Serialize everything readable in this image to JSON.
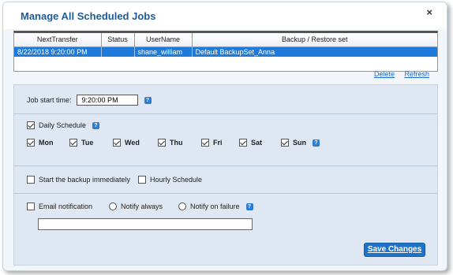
{
  "dialog": {
    "title": "Manage All Scheduled Jobs",
    "close_label": "×"
  },
  "table": {
    "columns": [
      "NextTransfer",
      "Status",
      "UserName",
      "Backup / Restore set"
    ],
    "rows": [
      {
        "next_transfer": "8/22/2018 9:20:00 PM",
        "status": "",
        "username": "shane_william",
        "backup_set": "Default BackupSet_Anna",
        "selected": true
      }
    ]
  },
  "links": {
    "delete": "Delete",
    "refresh": "Refresh"
  },
  "job_start": {
    "label": "Job start time:",
    "value": "9:20:00 PM",
    "help": "?"
  },
  "daily": {
    "label": "Daily Schedule",
    "checked": true,
    "help": "?",
    "days": [
      {
        "label": "Mon",
        "checked": true
      },
      {
        "label": "Tue",
        "checked": true
      },
      {
        "label": "Wed",
        "checked": true
      },
      {
        "label": "Thu",
        "checked": true
      },
      {
        "label": "Fri",
        "checked": true
      },
      {
        "label": "Sat",
        "checked": true
      },
      {
        "label": "Sun",
        "checked": true
      }
    ],
    "days_help": "?"
  },
  "options": {
    "start_immediately": "Start the backup immediately",
    "hourly": "Hourly Schedule"
  },
  "email": {
    "label": "Email notification",
    "notify_always": "Notify always",
    "notify_failure": "Notify on failure",
    "help": "?",
    "value": ""
  },
  "save_button": "Save Changes",
  "colors": {
    "accent": "#1f74c9",
    "title": "#1f5a96",
    "selection": "#1e7bdc",
    "panel": "#dfe8f2"
  }
}
